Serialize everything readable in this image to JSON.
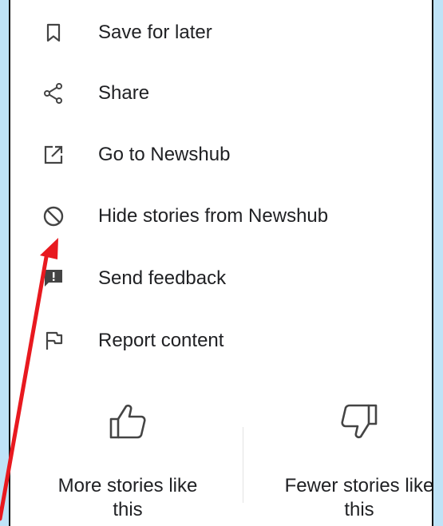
{
  "menu": {
    "items": [
      {
        "label": "Save for later",
        "icon": "bookmark-icon"
      },
      {
        "label": "Share",
        "icon": "share-icon"
      },
      {
        "label": "Go to Newshub",
        "icon": "open-in-new-icon"
      },
      {
        "label": "Hide stories from Newshub",
        "icon": "block-icon"
      },
      {
        "label": "Send feedback",
        "icon": "feedback-icon"
      },
      {
        "label": "Report content",
        "icon": "flag-icon"
      }
    ]
  },
  "feedback": {
    "more_label": "More stories like\nthis",
    "fewer_label": "Fewer stories like\nthis",
    "more_icon": "thumbs-up-icon",
    "fewer_icon": "thumbs-down-icon"
  },
  "annotation": {
    "arrow_color": "#e8191f"
  }
}
